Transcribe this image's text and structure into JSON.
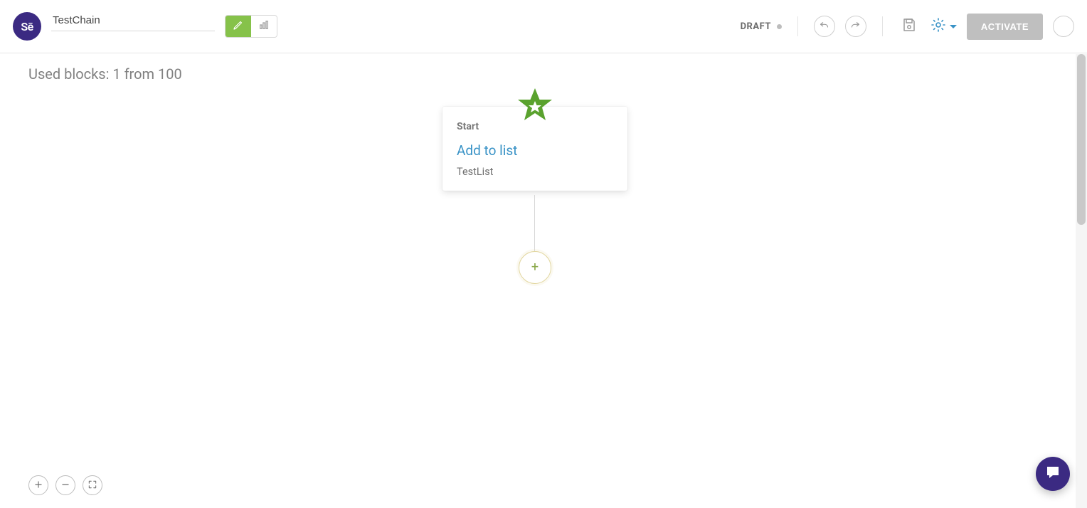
{
  "logo_text": "Sē",
  "header": {
    "title_value": "TestChain",
    "status_label": "DRAFT",
    "activate_label": "ACTIVATE"
  },
  "canvas": {
    "used_blocks_text": "Used blocks: 1 from 100",
    "node": {
      "section_label": "Start",
      "title": "Add to list",
      "subtitle": "TestList"
    },
    "add_node_glyph": "+"
  }
}
